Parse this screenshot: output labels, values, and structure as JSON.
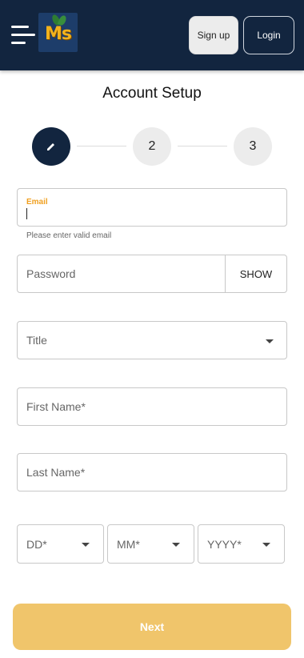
{
  "header": {
    "logo_text": "Ms",
    "signup_label": "Sign up",
    "login_label": "Login"
  },
  "page_title": "Account Setup",
  "stepper": {
    "step2": "2",
    "step3": "3"
  },
  "form": {
    "email_label": "Email",
    "email_value": "",
    "email_helper": "Please enter valid email",
    "password_placeholder": "Password",
    "password_toggle": "SHOW",
    "title_placeholder": "Title",
    "first_name_placeholder": "First Name*",
    "last_name_placeholder": "Last Name*",
    "day_placeholder": "DD*",
    "month_placeholder": "MM*",
    "year_placeholder": "YYYY*"
  },
  "next_label": "Next",
  "colors": {
    "header_bg": "#12253f",
    "accent": "#f0a020",
    "next_button": "#f0c56b"
  }
}
